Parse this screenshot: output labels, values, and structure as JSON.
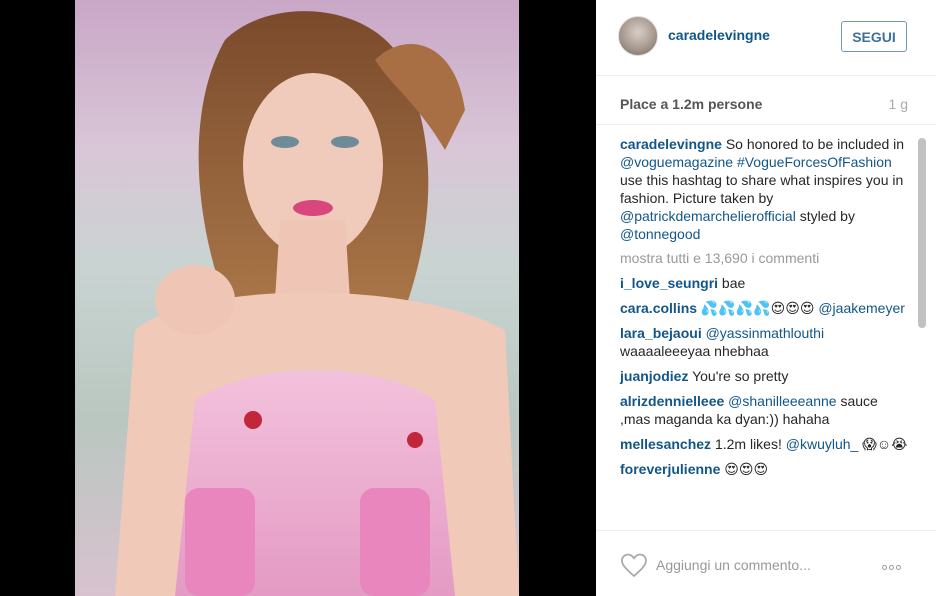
{
  "post": {
    "image_alt": "Portrait photo",
    "username": "caradelevingne",
    "follow_label": "SEGUI",
    "likes_text": "Place a 1.2m persone",
    "time_text": "1 g",
    "caption": {
      "user": "caradelevingne",
      "text_1": " So honored to be included in ",
      "mention_1": "@voguemagazine",
      "text_2": " ",
      "hashtag": "#VogueForcesOfFashion",
      "text_3": " use this hashtag to share what inspires you in fashion. Picture taken by ",
      "mention_2": "@patrickdemarchelierofficial",
      "text_4": " styled by ",
      "mention_3": "@tonnegood"
    },
    "view_all": "mostra tutti e 13,690 i commenti",
    "comments": [
      {
        "user": "i_love_seungri",
        "pre": "",
        "mention": "",
        "text": " bae"
      },
      {
        "user": "cara.collins",
        "pre": " 💦💦💦💦😍😍😍 ",
        "mention": "@jaakemeyer",
        "text": ""
      },
      {
        "user": "lara_bejaoui",
        "pre": " ",
        "mention": "@yassinmathlouthi",
        "text": " waaaaleeeyaa nhebhaa"
      },
      {
        "user": "juanjodiez",
        "pre": "",
        "mention": "",
        "text": " You're so pretty"
      },
      {
        "user": "alrizdennielleee",
        "pre": " ",
        "mention": "@shanilleeeanne",
        "text": " sauce ,mas maganda ka dyan:)) hahaha"
      },
      {
        "user": "mellesanchez",
        "pre": " 1.2m likes! ",
        "mention": "@kwuyluh_",
        "text": " 😱☺😭"
      },
      {
        "user": "foreverjulienne",
        "pre": " 😍😍😍",
        "mention": "",
        "text": ""
      }
    ]
  },
  "footer": {
    "comment_placeholder": "Aggiungi un commento...",
    "like_icon": "heart-icon",
    "more_icon": "more-options-icon"
  },
  "colors": {
    "link": "#125688",
    "follow_border": "#6f97b6",
    "muted": "#999999"
  }
}
